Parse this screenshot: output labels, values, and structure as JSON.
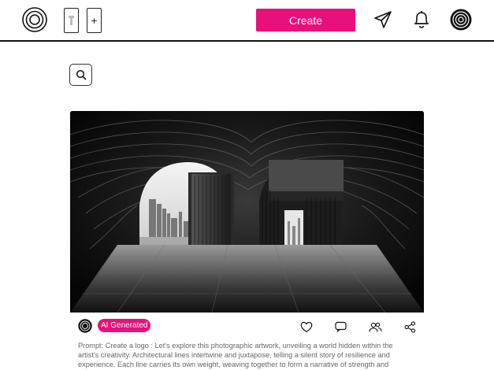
{
  "header": {
    "logo_icon": "concentric-circles-logo-icon",
    "device_buttons": [
      {
        "icon": "mobile-device-icon",
        "glyph": "▮"
      },
      {
        "icon": "add-device-icon",
        "glyph": "+"
      }
    ],
    "create_label": "Create",
    "send_icon": "paper-plane-icon",
    "notifications_icon": "bell-icon",
    "profile_icon": "profile-avatar-icon"
  },
  "search": {
    "icon": "search-icon"
  },
  "post": {
    "image_icon": "artwork-image",
    "badge": "AI Generated",
    "actions": [
      {
        "name": "like",
        "icon": "heart-icon"
      },
      {
        "name": "comment",
        "icon": "comment-icon"
      },
      {
        "name": "collaborators",
        "icon": "people-icon"
      },
      {
        "name": "share",
        "icon": "share-icon"
      }
    ],
    "prompt": "Prompt: Create a logo : Let's explore this photographic artwork, unveiling a world hidden within the artist's creativity. Architectural lines intertwine and juxtapose, telling a silent story of resilience and experience. Each line carries its own weight, weaving together to form a narrative of strength and perseverance. From"
  },
  "colors": {
    "accent": "#e8107a",
    "border": "#111111",
    "prompt_text": "#666666"
  }
}
